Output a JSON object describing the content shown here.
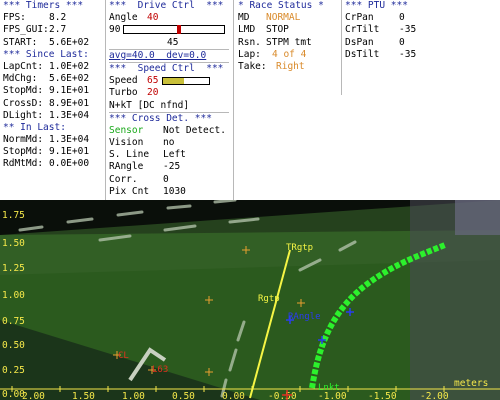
{
  "timers": {
    "header": "*** Timers ***",
    "rows": [
      {
        "label": "FPS:",
        "value": "8.2"
      },
      {
        "label": "FPS_GUI:",
        "value": "2.7"
      },
      {
        "label": "START:",
        "value": "5.6E+02"
      }
    ],
    "since_header": "*** Since Last:",
    "since_rows": [
      {
        "label": "LapCnt:",
        "value": "1.0E+02"
      },
      {
        "label": "MdChg:",
        "value": "5.6E+02"
      },
      {
        "label": "StopMd:",
        "value": "9.1E+01"
      },
      {
        "label": "CrossD:",
        "value": "8.9E+01"
      },
      {
        "label": "DLight:",
        "value": "1.3E+04"
      }
    ],
    "in_last_header": "** In Last:",
    "in_last_rows": [
      {
        "label": "NormMd:",
        "value": "1.3E+04"
      },
      {
        "label": "StopMd:",
        "value": "9.1E+01"
      },
      {
        "label": "RdMtMd:",
        "value": "0.0E+00"
      }
    ]
  },
  "drive_ctrl": {
    "header": "***  Drive Ctrl  ***",
    "angle_label": "Angle",
    "angle_value": "40",
    "angle_min": "90",
    "angle_max": "0",
    "angle_level": 0.55,
    "angle_center": "45",
    "avg_text": "avg=40.0  dev=0.0",
    "speed_header": "***  Speed Ctrl  ***",
    "speed_label": "Speed",
    "speed_value": "65",
    "speed_level": 0.45,
    "turbo_label": "Turbo",
    "turbo_value": "20",
    "nkt_text": "N+kT [DC nfnd]",
    "cross_header": "*** Cross Det. ***",
    "cross_rows": [
      {
        "label": "Sensor",
        "value": "Not Detect."
      },
      {
        "label": "Vision",
        "value": "no"
      },
      {
        "label": "S. Line",
        "value": "Left"
      },
      {
        "label": "RAngle",
        "value": "-25"
      },
      {
        "label": "Corr.",
        "value": "0"
      },
      {
        "label": "Pix Cnt",
        "value": "1030"
      }
    ]
  },
  "race_status": {
    "header": "* Race Status *",
    "md_label": "MD",
    "md_value": "NORMAL",
    "lmd_label": "LMD",
    "lmd_value": "STOP",
    "rsn_label": "Rsn.",
    "rsn_value": "STPM tmt",
    "lap_label": "Lap:",
    "lap_value": "4 of 4",
    "take_label": "Take:",
    "take_value": "Right"
  },
  "ptu": {
    "header": "*** PTU ***",
    "rows": [
      {
        "label": "CrPan",
        "value": "0"
      },
      {
        "label": "CrTilt",
        "value": "-35"
      },
      {
        "label": "DsPan",
        "value": "0"
      },
      {
        "label": "DsTilt",
        "value": "-35"
      }
    ]
  },
  "camera_view": {
    "y_ticks": [
      "1.75",
      "1.50",
      "1.25",
      "1.00",
      "0.75",
      "0.50",
      "0.25",
      "0.00"
    ],
    "x_ticks": [
      "2.00",
      "1.50",
      "1.00",
      "0.50",
      "0.00",
      "-0.50",
      "-1.00",
      "-1.50",
      "-2.00"
    ],
    "units": "meters",
    "labels": {
      "tr_gtp": "TRgtp",
      "r_gtp": "Rgtp",
      "r_angle": "RAngle",
      "r_l": "Rl",
      "l_label": "Lnkt",
      "c_label": "CL",
      "c_label2": "L63"
    },
    "colors": {
      "ground": "#2b5a1e",
      "line_green": "#2cf02c",
      "line_yellow": "#f5f545",
      "axis_yellow": "#f5e84a",
      "mark_orange": "#e8a030",
      "blue_mark": "#2a3cf0",
      "red_mark": "#e03020"
    }
  }
}
